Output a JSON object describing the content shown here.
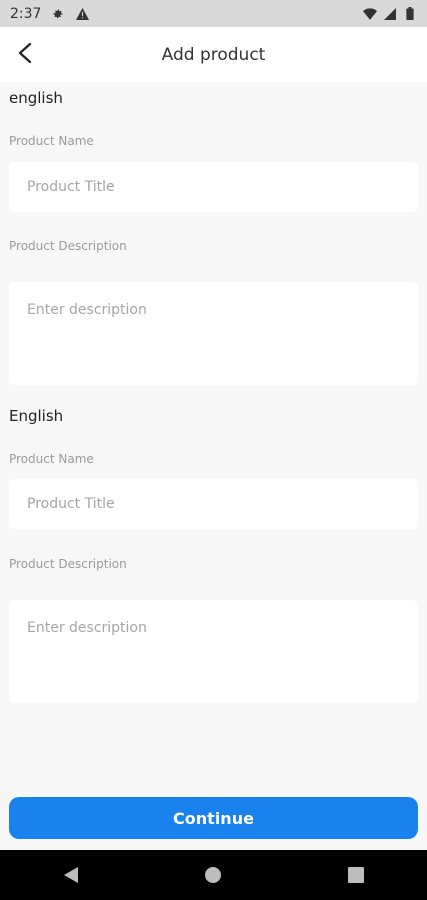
{
  "status_bar": {
    "time": "2:37",
    "icons": [
      "settings-gear-icon",
      "warning-icon",
      "wifi-icon",
      "cell-signal-icon",
      "battery-icon"
    ]
  },
  "app_bar": {
    "title": "Add product",
    "back_icon": "back-arrow-icon"
  },
  "sections": [
    {
      "language": "english",
      "name_label": "Product Name",
      "name_placeholder": "Product Title",
      "description_label": "Product Description",
      "description_placeholder": "Enter description"
    },
    {
      "language": "English",
      "name_label": "Product Name",
      "name_placeholder": "Product Title",
      "description_label": "Product Description",
      "description_placeholder": "Enter description"
    }
  ],
  "actions": {
    "continue_label": "Continue"
  },
  "colors": {
    "primary": "#1a82ef",
    "background": "#f7f7f7",
    "status_bar": "#d9d9d9"
  },
  "nav_bar": {
    "buttons": [
      "back-triangle-icon",
      "home-circle-icon",
      "recents-square-icon"
    ]
  }
}
